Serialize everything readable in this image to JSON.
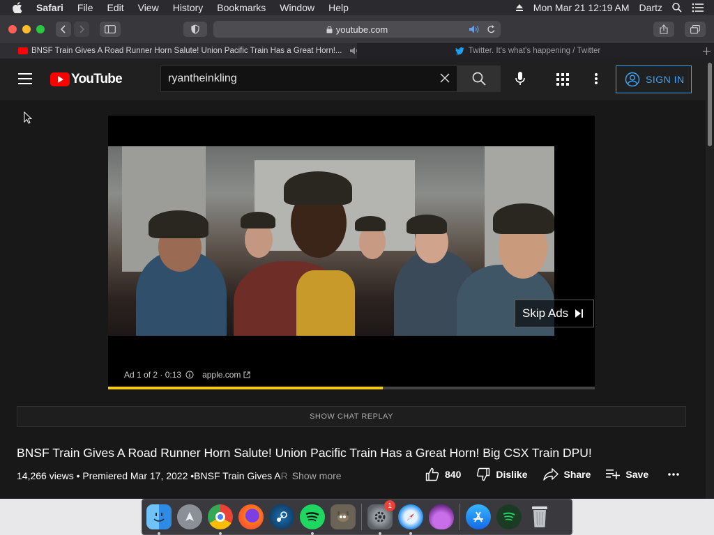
{
  "menubar": {
    "app": "Safari",
    "items": [
      "File",
      "Edit",
      "View",
      "History",
      "Bookmarks",
      "Window",
      "Help"
    ],
    "clock": "Mon Mar 21  12:19 AM",
    "user": "Dartz"
  },
  "browser": {
    "url": "youtube.com",
    "tabs": [
      {
        "title": "BNSF Train Gives A Road Runner Horn Salute! Union Pacific Train Has a Great Horn!...",
        "active": true
      },
      {
        "title": "Twitter. It's what's happening / Twitter",
        "active": false
      }
    ]
  },
  "youtube": {
    "logo_text": "YouTube",
    "search_value": "ryantheinkling",
    "sign_in_label": "SIGN IN",
    "player": {
      "skip_label": "Skip Ads",
      "ad_counter": "Ad 1 of 2 · 0:13",
      "ad_link": "apple.com",
      "progress": 0.565
    },
    "chat_replay_label": "SHOW CHAT REPLAY",
    "video": {
      "title": "BNSF Train Gives A Road Runner Horn Salute! Union Pacific Train Has a Great Horn! Big CSX Train DPU!",
      "views_date": "14,266 views • Premiered Mar 17, 2022 • ",
      "desc_visible": "BNSF Train Gives A",
      "desc_faded": " R",
      "show_more": "Show more",
      "likes": "840",
      "dislike_label": "Dislike",
      "share_label": "Share",
      "save_label": "Save"
    }
  },
  "dock": {
    "apps": [
      "Finder",
      "Launchpad",
      "Chrome",
      "Firefox",
      "Steam",
      "Spotify",
      "GIMP",
      "System Preferences",
      "Safari",
      "Tor",
      "App Store",
      "Spotify Helper",
      "Trash"
    ],
    "system_prefs_badge": "1"
  },
  "colors": {
    "youtube_red": "#ff0000",
    "youtube_bg": "#181818",
    "accent_blue": "#3ea6ff",
    "ad_progress": "#ffcc00"
  }
}
